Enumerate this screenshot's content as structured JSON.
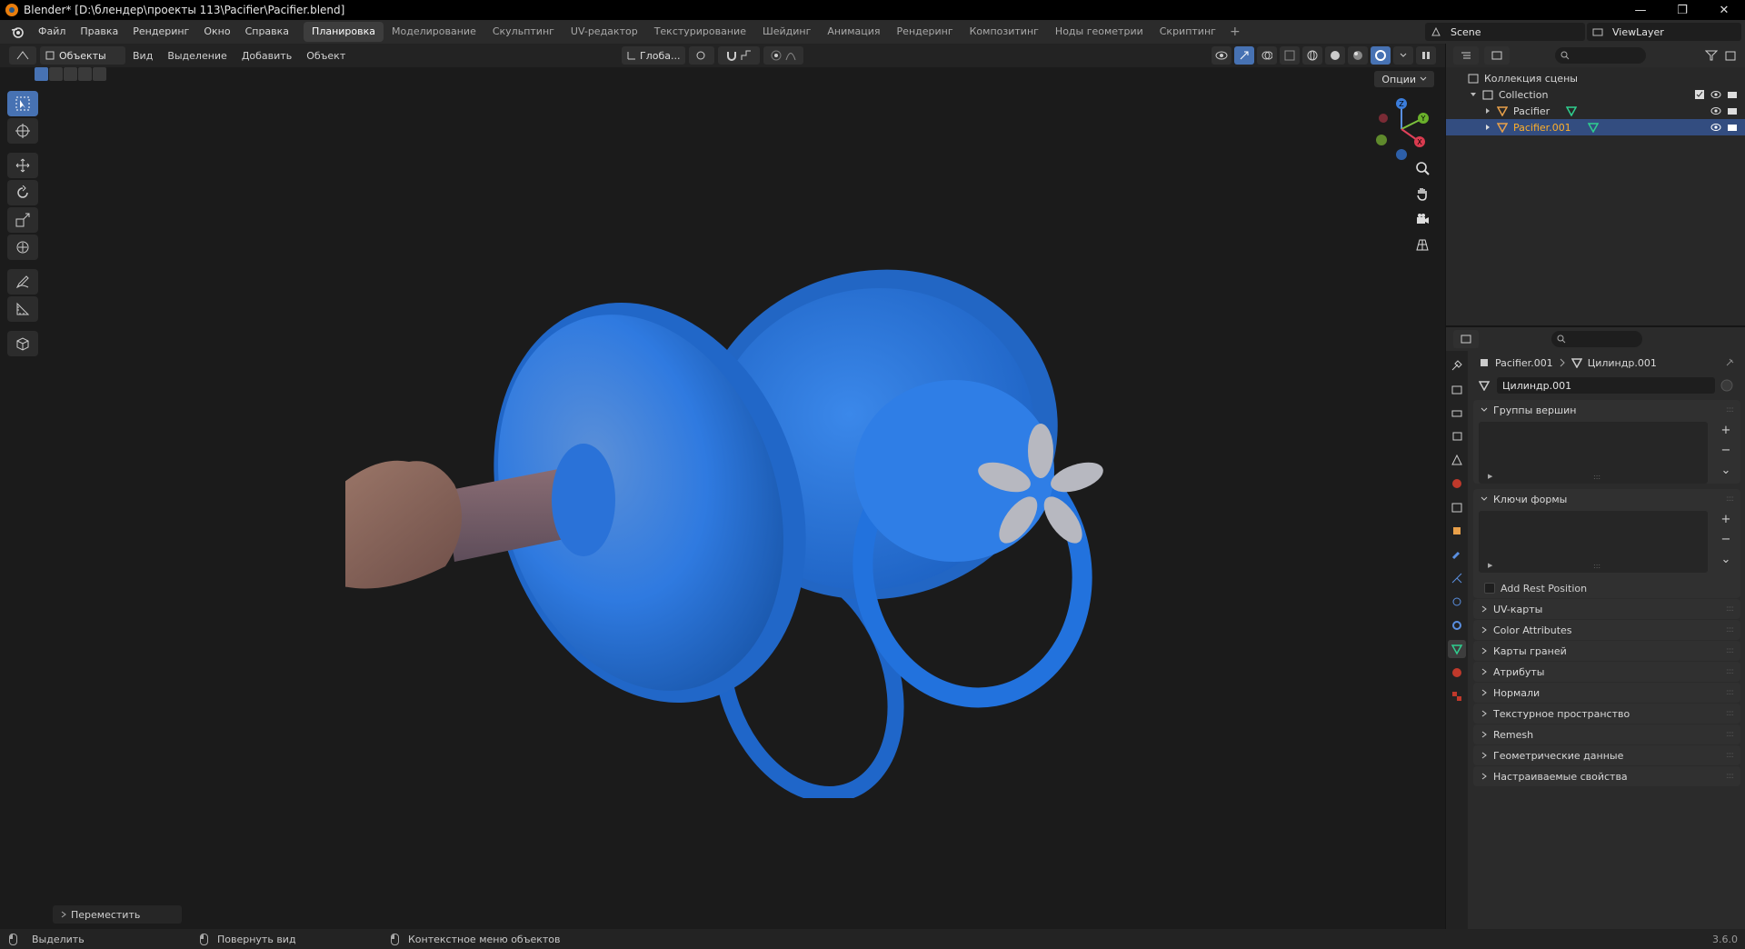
{
  "window": {
    "title": "Blender* [D:\\блендер\\проекты 113\\Pacifier\\Pacifier.blend]",
    "minimize": "—",
    "maximize": "❐",
    "close": "✕"
  },
  "menu": {
    "items": [
      "Файл",
      "Правка",
      "Рендеринг",
      "Окно",
      "Справка"
    ]
  },
  "workspaces": {
    "tabs": [
      "Планировка",
      "Моделирование",
      "Скульптинг",
      "UV-редактор",
      "Текстурирование",
      "Шейдинг",
      "Анимация",
      "Рендеринг",
      "Композитинг",
      "Ноды геометрии",
      "Скриптинг"
    ],
    "active_index": 0,
    "add": "+"
  },
  "scene": {
    "name": "Scene"
  },
  "view_layer": {
    "name": "ViewLayer"
  },
  "viewport": {
    "mode": "Объекты",
    "menus": [
      "Вид",
      "Выделение",
      "Добавить",
      "Объект"
    ],
    "orientation": "Глоба...",
    "options": "Опции",
    "last_operator": "Переместить"
  },
  "outliner": {
    "root": "Коллекция сцены",
    "collection": "Collection",
    "objects": [
      {
        "name": "Pacifier",
        "selected": false
      },
      {
        "name": "Pacifier.001",
        "selected": true
      }
    ]
  },
  "properties": {
    "object_name": "Pacifier.001",
    "mesh_name": "Цилиндр.001",
    "data_field": "Цилиндр.001",
    "panels": {
      "vertex_groups": "Группы вершин",
      "shape_keys": "Ключи формы",
      "add_rest_position": "Add Rest Position",
      "collapsed": [
        "UV-карты",
        "Color Attributes",
        "Карты граней",
        "Атрибуты",
        "Нормали",
        "Текстурное пространство",
        "Remesh",
        "Геометрические данные",
        "Настраиваемые свойства"
      ]
    }
  },
  "status": {
    "select": "Выделить",
    "rotate": "Повернуть вид",
    "context": "Контекстное меню объектов",
    "version": "3.6.0"
  },
  "colors": {
    "accent_blue": "#4772b3",
    "selected_row": "#334d80",
    "active_object_text": "#ffaf29",
    "pacifier_blue": "#2c74d4",
    "nipple_color": "#8a6a60"
  }
}
